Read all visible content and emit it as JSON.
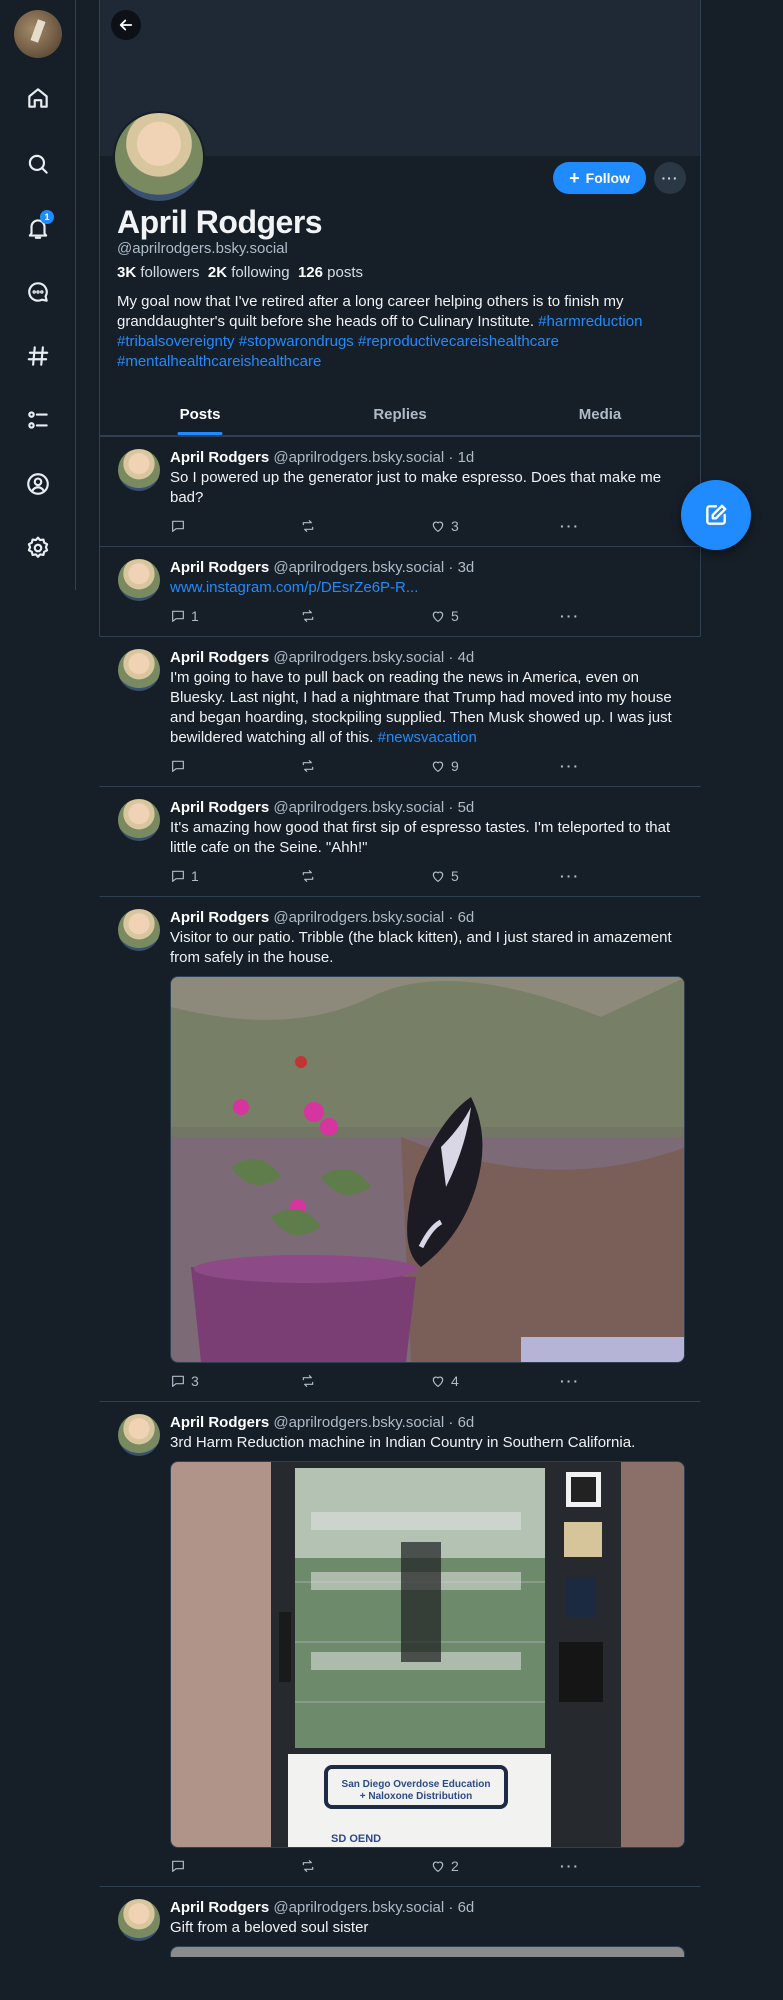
{
  "nav": {
    "badge_count": "1"
  },
  "profile": {
    "name": "April Rodgers",
    "handle": "@aprilrodgers.bsky.social",
    "followers_count": "3K",
    "followers_label": "followers",
    "following_count": "2K",
    "following_label": "following",
    "posts_count": "126",
    "posts_label": "posts",
    "follow_label": "Follow",
    "bio_text": "My goal now that I've retired after a long career helping others is to finish my granddaughter's quilt before she heads off to Culinary Institute. ",
    "bio_tags": [
      "#harmreduction",
      "#tribalsovereignty",
      "#stopwarondrugs",
      "#reproductivecareishealthcare",
      "#mentalhealthcareishealthcare"
    ]
  },
  "tabs": [
    "Posts",
    "Replies",
    "Media"
  ],
  "posts": [
    {
      "author": "April Rodgers",
      "handle": "@aprilrodgers.bsky.social",
      "time": "1d",
      "text": "So I powered up the generator just to make espresso. Does that make me bad?",
      "link": "",
      "tag": "",
      "replies": "",
      "reposts": "",
      "likes": "3"
    },
    {
      "author": "April Rodgers",
      "handle": "@aprilrodgers.bsky.social",
      "time": "3d",
      "text": "",
      "link": "www.instagram.com/p/DEsrZe6P-R...",
      "tag": "",
      "replies": "1",
      "reposts": "",
      "likes": "5"
    },
    {
      "author": "April Rodgers",
      "handle": "@aprilrodgers.bsky.social",
      "time": "4d",
      "text": "I'm going to have to pull back on reading the news in America, even on Bluesky. Last night, I had a nightmare  that Trump had moved into my house and began hoarding, stockpiling supplied. Then Musk showed up. I was just bewildered watching all of this. ",
      "link": "",
      "tag": "#newsvacation",
      "replies": "",
      "reposts": "",
      "likes": "9"
    },
    {
      "author": "April Rodgers",
      "handle": "@aprilrodgers.bsky.social",
      "time": "5d",
      "text": "It's amazing how good that first sip of espresso tastes. I'm teleported to that little cafe on the Seine. \"Ahh!\"",
      "link": "",
      "tag": "",
      "replies": "1",
      "reposts": "",
      "likes": "5"
    },
    {
      "author": "April Rodgers",
      "handle": "@aprilrodgers.bsky.social",
      "time": "6d",
      "text": "Visitor to our patio. Tribble (the black kitten), and I just stared in amazement from safely in the house.",
      "link": "",
      "tag": "",
      "replies": "3",
      "reposts": "",
      "likes": "4"
    },
    {
      "author": "April Rodgers",
      "handle": "@aprilrodgers.bsky.social",
      "time": "6d",
      "text": "3rd Harm Reduction machine in Indian Country in Southern California.",
      "link": "",
      "tag": "",
      "replies": "",
      "reposts": "",
      "likes": "2",
      "sign_line1": "San Diego Overdose Education",
      "sign_line2": "+ Naloxone Distribution",
      "sign_org": "SD OEND"
    },
    {
      "author": "April Rodgers",
      "handle": "@aprilrodgers.bsky.social",
      "time": "6d",
      "text": "Gift from a beloved soul sister",
      "link": "",
      "tag": "",
      "replies": "",
      "reposts": "",
      "likes": ""
    }
  ],
  "icons": {
    "nav": [
      "home-icon",
      "search-icon",
      "bell-icon",
      "chat-icon",
      "hashtag-icon",
      "list-icon",
      "profile-icon",
      "gear-icon"
    ],
    "post_actions": [
      "reply-icon",
      "repost-icon",
      "like-icon",
      "more-icon"
    ]
  },
  "colors": {
    "accent": "#208bfe",
    "background": "#161e27",
    "border": "#2e4052"
  }
}
